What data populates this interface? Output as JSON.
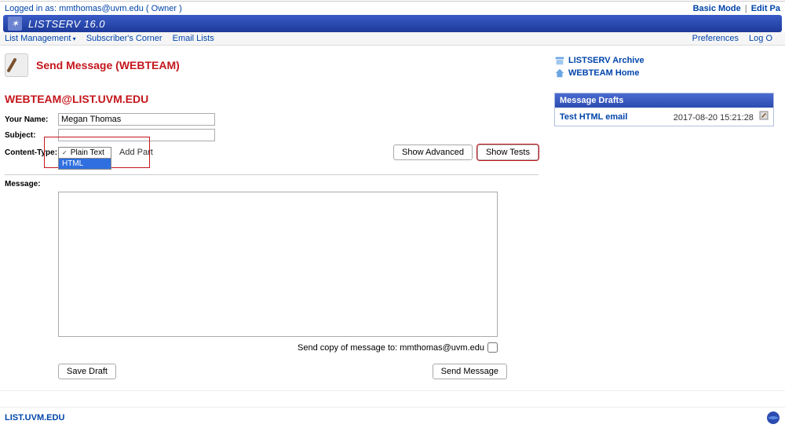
{
  "topbar": {
    "login_text": "Logged in as: mmthomas@uvm.edu ( Owner )",
    "basic_mode": "Basic Mode",
    "edit_page": "Edit Pa"
  },
  "titlebar": {
    "product": "LISTSERV 16.0"
  },
  "menu": {
    "list_management": "List Management",
    "subscribers_corner": "Subscriber's Corner",
    "email_lists": "Email Lists",
    "preferences": "Preferences",
    "logout": "Log O"
  },
  "page": {
    "title": "Send Message (WEBTEAM)",
    "list_address": "WEBTEAM@LIST.UVM.EDU"
  },
  "form": {
    "your_name_label": "Your Name:",
    "your_name_value": "Megan Thomas",
    "subject_label": "Subject:",
    "subject_value": "",
    "content_type_label": "Content-Type:",
    "content_type_options": {
      "plain": "Plain Text",
      "html": "HTML"
    },
    "add_part": "Add Part",
    "show_advanced": "Show Advanced",
    "show_tests": "Show Tests",
    "message_label": "Message:",
    "message_value": "",
    "send_copy_label": "Send copy of message to: mmthomas@uvm.edu",
    "save_draft": "Save Draft",
    "send_message": "Send Message"
  },
  "sidebar": {
    "archive": "LISTSERV Archive",
    "home": "WEBTEAM Home",
    "drafts_header": "Message Drafts",
    "drafts": [
      {
        "title": "Test HTML email",
        "timestamp": "2017-08-20 15:21:28"
      }
    ]
  },
  "footer": {
    "host": "LIST.UVM.EDU"
  }
}
